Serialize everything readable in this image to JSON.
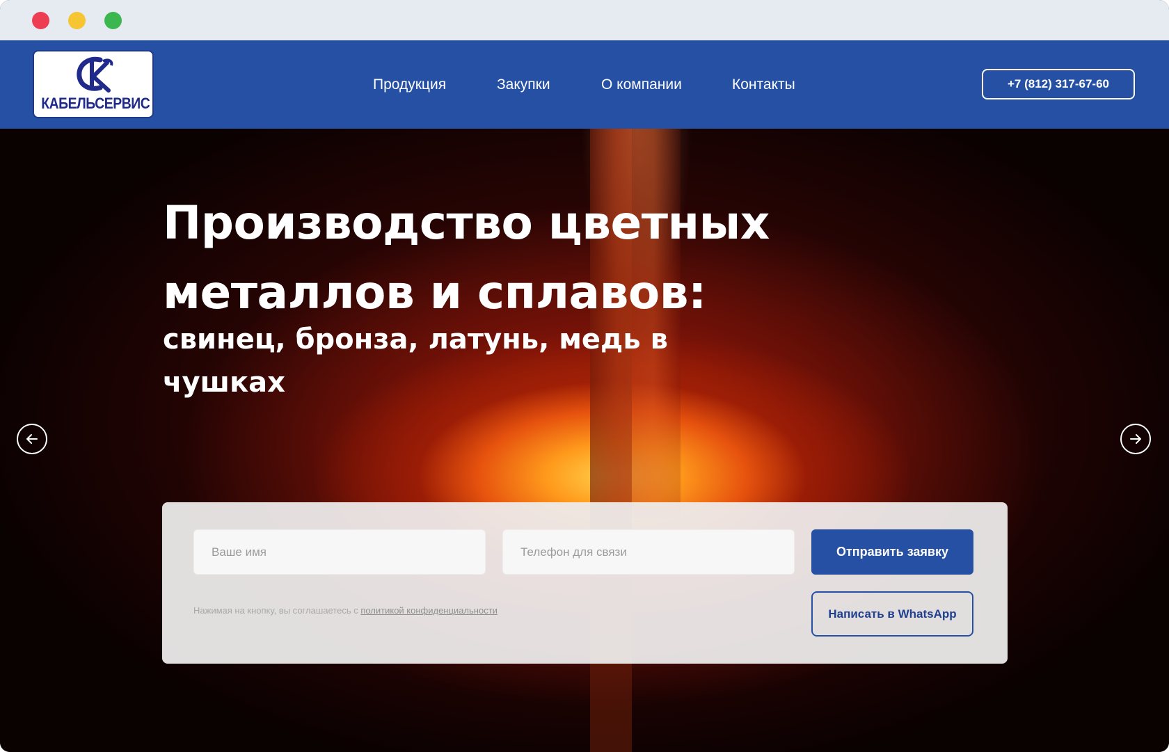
{
  "window": {
    "controls": [
      "close",
      "minimize",
      "maximize"
    ],
    "colors": {
      "close": "#ec3d53",
      "minimize": "#f5c533",
      "maximize": "#3cb750"
    }
  },
  "header": {
    "logo_text": "КАБЕЛЬСЕРВИС",
    "nav": [
      "Продукция",
      "Закупки",
      "О компании",
      "Контакты"
    ],
    "phone": "+7 (812) 317-67-60",
    "bg_color": "#2550a4"
  },
  "hero": {
    "title": "Производство цветных металлов и сплавов:",
    "subtitle": "свинец, бронза, латунь, медь в чушках",
    "prev_icon": "arrow-left-icon",
    "next_icon": "arrow-right-icon"
  },
  "form": {
    "name_placeholder": "Ваше имя",
    "phone_placeholder": "Телефон для связи",
    "submit_label": "Отправить заявку",
    "whatsapp_label": "Написать в WhatsApp",
    "consent_text": "Нажимая на кнопку, вы соглашаетесь с ",
    "consent_link": "политикой конфиденциальности"
  }
}
